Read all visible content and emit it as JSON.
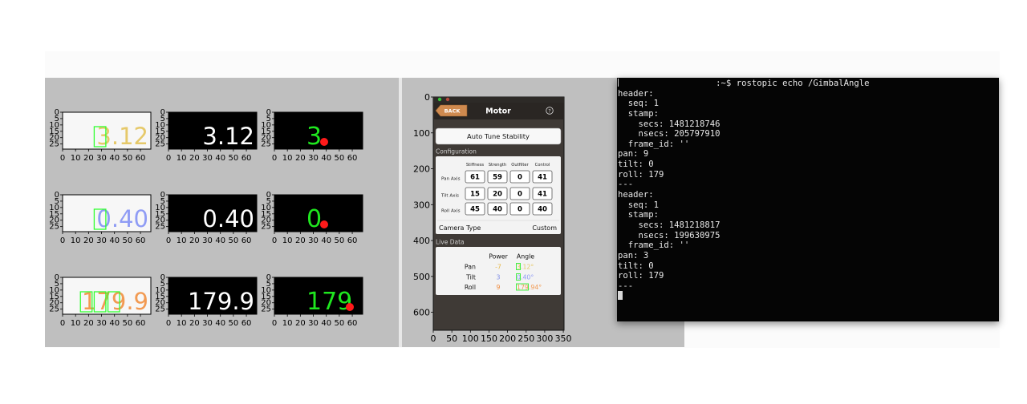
{
  "axis_ticks": {
    "digit_y": [
      "0",
      "5",
      "10",
      "15",
      "20",
      "25"
    ],
    "digit_x": [
      "0",
      "10",
      "20",
      "30",
      "40",
      "50",
      "60"
    ],
    "phone_y": [
      "0",
      "100",
      "200",
      "300",
      "400",
      "500",
      "600"
    ],
    "phone_x": [
      "0",
      "50",
      "100",
      "150",
      "200",
      "250",
      "300",
      "350"
    ]
  },
  "digit_rows": [
    {
      "colored_text": "3.12",
      "colored_color": "#e6c96a",
      "box_text": "3",
      "white_text": "3.12",
      "green_text": "3"
    },
    {
      "colored_text": "0.40",
      "colored_color": "#8f9cf5",
      "box_text": "0",
      "white_text": "0.40",
      "green_text": "0"
    },
    {
      "colored_text": "179.9",
      "colored_color": "#f29a52",
      "box_text": "179",
      "white_text": "179.9",
      "green_text": "179"
    }
  ],
  "phone": {
    "back_label": "BACK",
    "title": "Motor",
    "help_glyph": "?",
    "auto_tune_label": "Auto Tune Stability",
    "config_header": "Configuration",
    "config_columns": [
      "Stiffness",
      "Strength",
      "Outfilter",
      "Control"
    ],
    "config_rows": [
      {
        "label": "Pan Axis",
        "values": [
          "61",
          "59",
          "0",
          "41"
        ]
      },
      {
        "label": "Tilt Axis",
        "values": [
          "15",
          "20",
          "0",
          "41"
        ]
      },
      {
        "label": "Roll Axis",
        "values": [
          "45",
          "40",
          "0",
          "40"
        ]
      }
    ],
    "camera_type_label": "Camera Type",
    "camera_type_value": "Custom",
    "live_header": "Live Data",
    "live_columns": [
      "Power",
      "Angle"
    ],
    "live_rows": [
      {
        "label": "Pan",
        "power": "-7",
        "power_color": "#e6b84a",
        "angle": "3.12°",
        "angle_color": "#e6c96a"
      },
      {
        "label": "Tilt",
        "power": "3",
        "power_color": "#7f8de6",
        "angle": "0.40°",
        "angle_color": "#8f9cf5"
      },
      {
        "label": "Roll",
        "power": "9",
        "power_color": "#f08a3c",
        "angle": "179.94°",
        "angle_color": "#f29a52"
      }
    ]
  },
  "terminal": {
    "lines": [
      "                   :~$ rostopic echo /GimbalAngle",
      "header:",
      "  seq: 1",
      "  stamp:",
      "    secs: 1481218746",
      "    nsecs: 205797910",
      "  frame_id: ''",
      "pan: 9",
      "tilt: 0",
      "roll: 179",
      "---",
      "header:",
      "  seq: 1",
      "  stamp:",
      "    secs: 1481218817",
      "    nsecs: 199630975",
      "  frame_id: ''",
      "pan: 3",
      "tilt: 0",
      "roll: 179",
      "---"
    ]
  }
}
